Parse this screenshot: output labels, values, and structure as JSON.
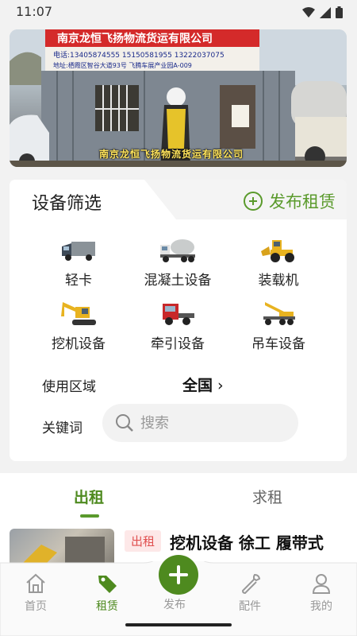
{
  "status_bar": {
    "time": "11:07"
  },
  "banner": {
    "sign_title": "南京龙恒飞扬物流货运有限公司",
    "sign_phone": "电话:13405874555  15150581955  13222037075",
    "sign_address": "地址:栖霞区智谷大道93号 飞腾车展产业园A-009",
    "caption": "南京龙恒飞扬物流货运有限公司",
    "slide_count": 5,
    "active_slide": 0
  },
  "filter": {
    "title": "设备筛选",
    "publish_label": "发布租赁",
    "categories": [
      {
        "label": "轻卡",
        "icon": "light-truck-icon"
      },
      {
        "label": "混凝土设备",
        "icon": "concrete-mixer-icon"
      },
      {
        "label": "装载机",
        "icon": "wheel-loader-icon"
      },
      {
        "label": "挖机设备",
        "icon": "excavator-icon"
      },
      {
        "label": "牵引设备",
        "icon": "tractor-truck-icon"
      },
      {
        "label": "吊车设备",
        "icon": "crane-truck-icon"
      }
    ],
    "area_label": "使用区域",
    "area_value": "全国",
    "keyword_label": "关键词",
    "search_placeholder": "搜索"
  },
  "tabs": [
    {
      "label": "出租",
      "active": true
    },
    {
      "label": "求租",
      "active": false
    }
  ],
  "listing": {
    "badge": "出租",
    "title": "挖机设备 徐工 履带式"
  },
  "bottom_nav": {
    "items": [
      {
        "label": "首页",
        "icon": "home-icon",
        "active": false
      },
      {
        "label": "租赁",
        "icon": "tag-icon",
        "active": true
      },
      {
        "label": "发布",
        "icon": "plus-icon",
        "active": false
      },
      {
        "label": "配件",
        "icon": "wrench-icon",
        "active": false
      },
      {
        "label": "我的",
        "icon": "user-icon",
        "active": false
      }
    ]
  },
  "colors": {
    "accent": "#4e8a1f",
    "accent_light": "#5a9a2c",
    "badge_bg": "#fde8e8",
    "badge_text": "#e05050"
  }
}
